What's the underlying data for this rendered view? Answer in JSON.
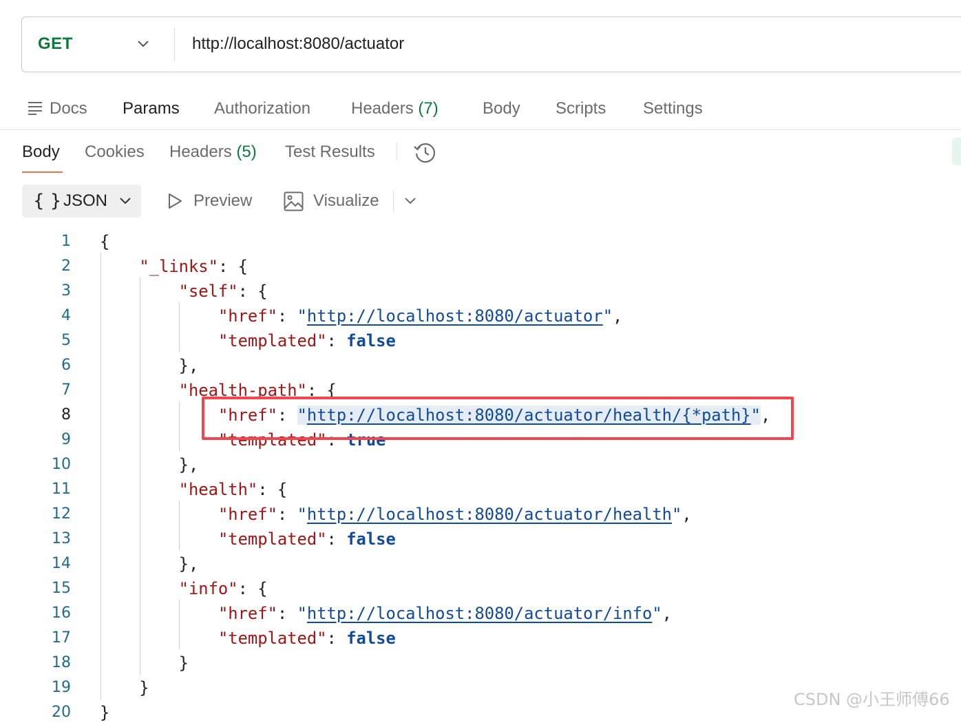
{
  "request": {
    "method": "GET",
    "url": "http://localhost:8080/actuator"
  },
  "request_tabs": {
    "docs": "Docs",
    "params": "Params",
    "authorization": "Authorization",
    "headers": "Headers",
    "headers_count": "(7)",
    "body": "Body",
    "scripts": "Scripts",
    "settings": "Settings"
  },
  "response_tabs": {
    "body": "Body",
    "cookies": "Cookies",
    "headers": "Headers",
    "headers_count": "(5)",
    "test_results": "Test Results"
  },
  "toolbar": {
    "format_braces": "{ }",
    "format": "JSON",
    "preview": "Preview",
    "visualize": "Visualize"
  },
  "icons": {
    "docs": "docs-lines-icon",
    "history": "history-clock-icon",
    "preview": "play-outline-icon",
    "visualize": "image-icon",
    "caret": "chevron-down-icon"
  },
  "colors": {
    "method": "#0b7a3b",
    "json_key": "#a31515",
    "json_link": "#0f4a9b",
    "line_number": "#1f6c8f",
    "highlight_box": "#f0464d",
    "active_underline": "#e8724a"
  },
  "code": {
    "line_numbers": [
      "1",
      "2",
      "3",
      "4",
      "5",
      "6",
      "7",
      "8",
      "9",
      "10",
      "11",
      "12",
      "13",
      "14",
      "15",
      "16",
      "17",
      "18",
      "19",
      "20"
    ],
    "k_links": "\"_links\"",
    "k_self": "\"self\"",
    "k_health_path": "\"health-path\"",
    "k_health": "\"health\"",
    "k_info": "\"info\"",
    "k_href": "\"href\"",
    "k_templated": "\"templated\"",
    "url_self": "http://localhost:8080/actuator",
    "url_health_path": "http://localhost:8080/actuator/health/{*path}",
    "url_health": "http://localhost:8080/actuator/health",
    "url_info": "http://localhost:8080/actuator/info",
    "val_false": "false",
    "val_true": "true"
  },
  "watermark": "CSDN @小王师傅66"
}
